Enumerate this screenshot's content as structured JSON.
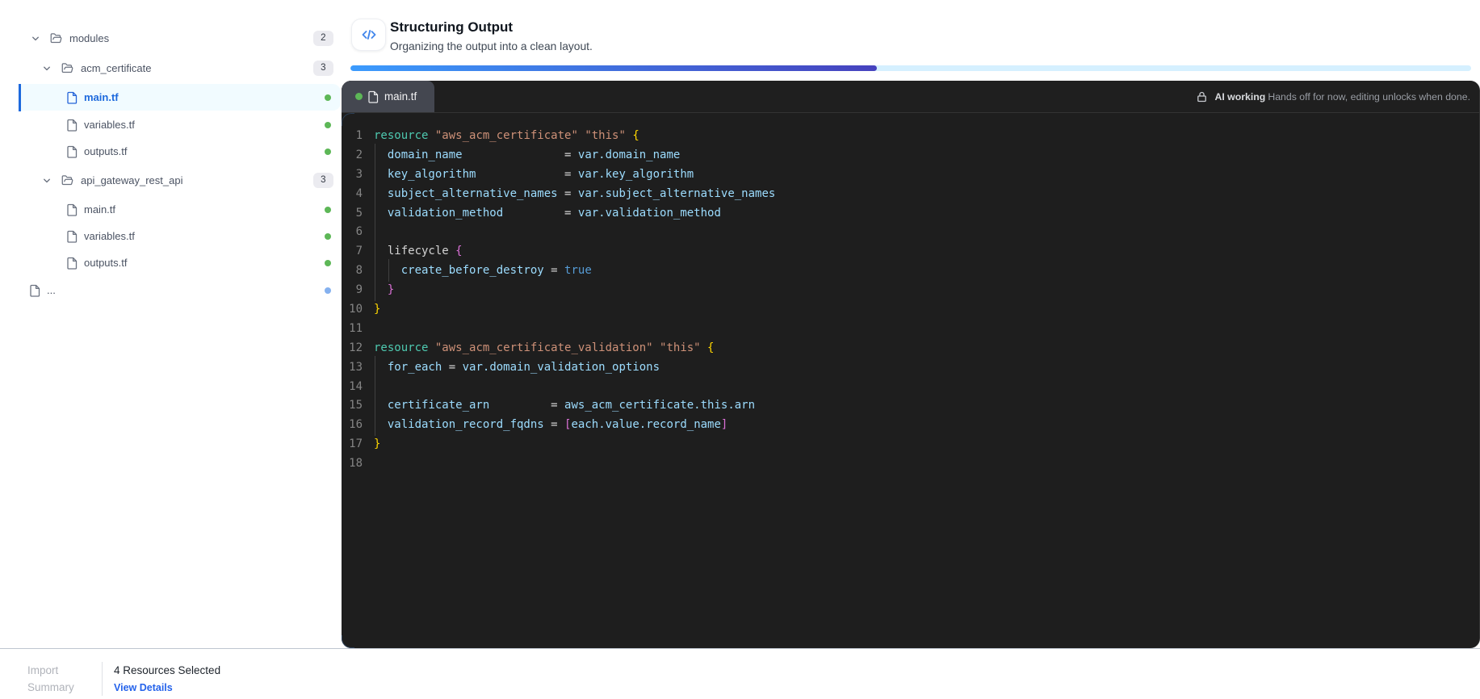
{
  "sidebar": {
    "tree": [
      {
        "id": "modules",
        "label": "modules",
        "type": "folder",
        "icon": "folder-icon",
        "chevron": "chevron-down-icon",
        "level": 0,
        "badge": "2",
        "expanded": true
      },
      {
        "id": "acm-certificate",
        "label": "acm_certificate",
        "type": "folder",
        "icon": "folder-icon",
        "chevron": "chevron-down-icon",
        "level": 1,
        "badge": "3",
        "expanded": true
      },
      {
        "id": "acm-main-tf",
        "label": "main.tf",
        "type": "file",
        "icon": "file-icon",
        "level": 2,
        "status_dot": "green",
        "selected": true
      },
      {
        "id": "acm-variables-tf",
        "label": "variables.tf",
        "type": "file",
        "icon": "file-icon",
        "level": 2,
        "status_dot": "green"
      },
      {
        "id": "acm-outputs-tf",
        "label": "outputs.tf",
        "type": "file",
        "icon": "file-icon",
        "level": 2,
        "status_dot": "green"
      },
      {
        "id": "api-gateway-rest-api",
        "label": "api_gateway_rest_api",
        "type": "folder",
        "icon": "folder-icon",
        "chevron": "chevron-down-icon",
        "level": 1,
        "badge": "3",
        "expanded": true
      },
      {
        "id": "api-main-tf",
        "label": "main.tf",
        "type": "file",
        "icon": "file-icon",
        "level": 2,
        "status_dot": "green"
      },
      {
        "id": "api-variables-tf",
        "label": "variables.tf",
        "type": "file",
        "icon": "file-icon",
        "level": 2,
        "status_dot": "green"
      },
      {
        "id": "api-outputs-tf",
        "label": "outputs.tf",
        "type": "file",
        "icon": "file-icon",
        "level": 2,
        "status_dot": "green"
      },
      {
        "id": "more",
        "label": "...",
        "type": "file",
        "icon": "file-icon",
        "level": 0,
        "status_dot": "blue"
      }
    ]
  },
  "header": {
    "title": "Structuring Output",
    "subtitle": "Organizing the output into a clean layout.",
    "icon": "code-icon",
    "progress_percent": 47
  },
  "editor": {
    "tab": {
      "filename": "main.tf",
      "modified_dot": "green",
      "icon": "file-icon"
    },
    "lock_note": {
      "icon": "lock-icon",
      "bold": "AI working",
      "text": "Hands off for now, editing unlocks when done."
    },
    "code": {
      "language": "terraform",
      "lines": [
        {
          "n": 1,
          "g": [],
          "t": [
            [
              "kw",
              "resource"
            ],
            [
              "pl",
              " "
            ],
            [
              "str",
              "\"aws_acm_certificate\""
            ],
            [
              "pl",
              " "
            ],
            [
              "str",
              "\"this\""
            ],
            [
              "pl",
              " "
            ],
            [
              "b1",
              "{"
            ]
          ]
        },
        {
          "n": 2,
          "g": [
            0
          ],
          "t": [
            [
              "pl",
              "  "
            ],
            [
              "pr",
              "domain_name"
            ],
            [
              "pl",
              "               "
            ],
            [
              "op",
              "="
            ],
            [
              "pl",
              " "
            ],
            [
              "pr",
              "var.domain_name"
            ]
          ]
        },
        {
          "n": 3,
          "g": [
            0
          ],
          "t": [
            [
              "pl",
              "  "
            ],
            [
              "pr",
              "key_algorithm"
            ],
            [
              "pl",
              "             "
            ],
            [
              "op",
              "="
            ],
            [
              "pl",
              " "
            ],
            [
              "pr",
              "var.key_algorithm"
            ]
          ]
        },
        {
          "n": 4,
          "g": [
            0
          ],
          "t": [
            [
              "pl",
              "  "
            ],
            [
              "pr",
              "subject_alternative_names"
            ],
            [
              "pl",
              " "
            ],
            [
              "op",
              "="
            ],
            [
              "pl",
              " "
            ],
            [
              "pr",
              "var.subject_alternative_names"
            ]
          ]
        },
        {
          "n": 5,
          "g": [
            0
          ],
          "t": [
            [
              "pl",
              "  "
            ],
            [
              "pr",
              "validation_method"
            ],
            [
              "pl",
              "         "
            ],
            [
              "op",
              "="
            ],
            [
              "pl",
              " "
            ],
            [
              "pr",
              "var.validation_method"
            ]
          ]
        },
        {
          "n": 6,
          "g": [
            0
          ],
          "t": []
        },
        {
          "n": 7,
          "g": [
            0
          ],
          "t": [
            [
              "pl",
              "  lifecycle "
            ],
            [
              "b2",
              "{"
            ]
          ]
        },
        {
          "n": 8,
          "g": [
            0,
            1
          ],
          "t": [
            [
              "pl",
              "    "
            ],
            [
              "pr",
              "create_before_destroy"
            ],
            [
              "pl",
              " "
            ],
            [
              "op",
              "="
            ],
            [
              "pl",
              " "
            ],
            [
              "bool",
              "true"
            ]
          ]
        },
        {
          "n": 9,
          "g": [
            0
          ],
          "t": [
            [
              "pl",
              "  "
            ],
            [
              "b2",
              "}"
            ]
          ]
        },
        {
          "n": 10,
          "g": [],
          "t": [
            [
              "b1",
              "}"
            ]
          ]
        },
        {
          "n": 11,
          "g": [],
          "t": []
        },
        {
          "n": 12,
          "g": [],
          "t": [
            [
              "kw",
              "resource"
            ],
            [
              "pl",
              " "
            ],
            [
              "str",
              "\"aws_acm_certificate_validation\""
            ],
            [
              "pl",
              " "
            ],
            [
              "str",
              "\"this\""
            ],
            [
              "pl",
              " "
            ],
            [
              "b1",
              "{"
            ]
          ]
        },
        {
          "n": 13,
          "g": [
            0
          ],
          "t": [
            [
              "pl",
              "  "
            ],
            [
              "pr",
              "for_each"
            ],
            [
              "pl",
              " "
            ],
            [
              "op",
              "="
            ],
            [
              "pl",
              " "
            ],
            [
              "pr",
              "var.domain_validation_options"
            ]
          ]
        },
        {
          "n": 14,
          "g": [
            0
          ],
          "t": []
        },
        {
          "n": 15,
          "g": [
            0
          ],
          "t": [
            [
              "pl",
              "  "
            ],
            [
              "pr",
              "certificate_arn"
            ],
            [
              "pl",
              "         "
            ],
            [
              "op",
              "="
            ],
            [
              "pl",
              " "
            ],
            [
              "pr",
              "aws_acm_certificate.this.arn"
            ]
          ]
        },
        {
          "n": 16,
          "g": [
            0
          ],
          "t": [
            [
              "pl",
              "  "
            ],
            [
              "pr",
              "validation_record_fqdns"
            ],
            [
              "pl",
              " "
            ],
            [
              "op",
              "="
            ],
            [
              "pl",
              " "
            ],
            [
              "b2",
              "["
            ],
            [
              "pr",
              "each.value.record_name"
            ],
            [
              "b2",
              "]"
            ]
          ]
        },
        {
          "n": 17,
          "g": [],
          "t": [
            [
              "b1",
              "}"
            ]
          ]
        },
        {
          "n": 18,
          "g": [],
          "t": []
        }
      ]
    }
  },
  "footer": {
    "label_line1": "Import",
    "label_line2": "Summary",
    "status": "4 Resources Selected",
    "link": "View Details"
  },
  "colors": {
    "accent": "#2563eb",
    "progress_start": "#3b9bfd",
    "progress_end": "#4642be",
    "progress_track": "#d5f0ff",
    "selected_bg": "#f0f9ff",
    "selected_bar": "#1d69dd",
    "dot_green": "#5db757",
    "dot_blue": "#85b1ef",
    "editor_bg": "#1e1e1e",
    "tabbar_bg": "#1f1f1f",
    "tab_active_bg": "#444750",
    "code_keyword": "#4ec9b0",
    "code_string": "#ce9178",
    "code_property": "#9cdcfe",
    "code_plain": "#d4d4d4",
    "code_bracket1": "#ffd700",
    "code_bracket2": "#da70d6",
    "code_bool": "#569cd6",
    "line_number": "#858585"
  }
}
